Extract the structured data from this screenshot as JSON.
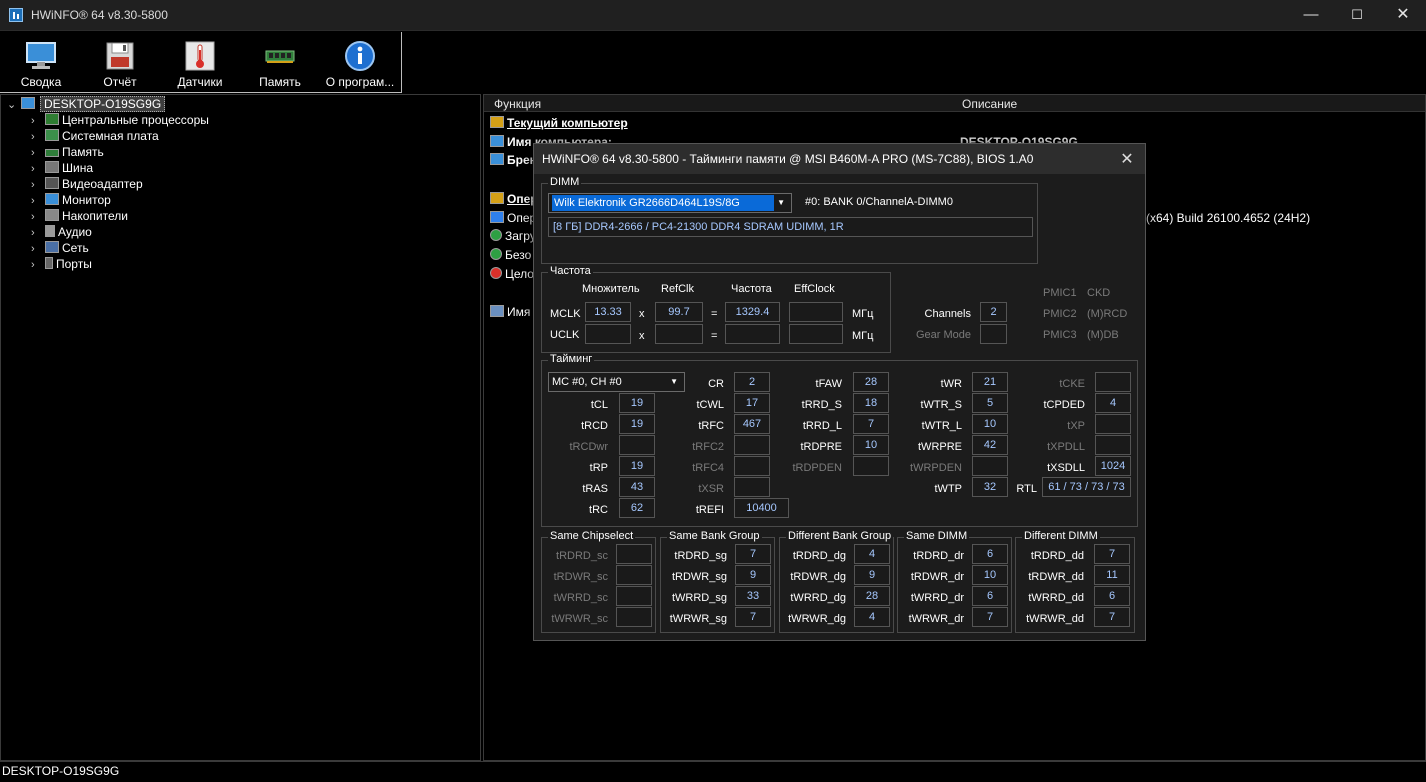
{
  "window": {
    "title": "HWiNFO® 64 v8.30-5800"
  },
  "toolbar": {
    "items": [
      {
        "label": "Сводка",
        "icon": "monitor-icon"
      },
      {
        "label": "Отчёт",
        "icon": "floppy-icon"
      },
      {
        "label": "Датчики",
        "icon": "thermometer-icon"
      },
      {
        "label": "Память",
        "icon": "memory-module-icon"
      },
      {
        "label": "О програм...",
        "icon": "info-icon"
      }
    ]
  },
  "tree": {
    "root": "DESKTOP-O19SG9G",
    "items": [
      {
        "label": "Центральные процессоры"
      },
      {
        "label": "Системная плата"
      },
      {
        "label": "Память"
      },
      {
        "label": "Шина"
      },
      {
        "label": "Видеоадаптер"
      },
      {
        "label": "Монитор"
      },
      {
        "label": "Накопители"
      },
      {
        "label": "Аудио"
      },
      {
        "label": "Сеть"
      },
      {
        "label": "Порты"
      }
    ]
  },
  "details": {
    "col_function": "Функция",
    "col_description": "Описание",
    "rows": [
      {
        "label": "Текущий компьютер"
      },
      {
        "label": "Имя компьютера:"
      },
      {
        "label": "Брен"
      },
      {
        "label": "Опер"
      },
      {
        "label": "Опер"
      },
      {
        "label": "Загру"
      },
      {
        "label": "Безо"
      },
      {
        "label": "Цело"
      },
      {
        "label": "Имя"
      }
    ],
    "desc_computer": "DESKTOP-O19SG9G",
    "desc_os": "l (x64) Build 26100.4652 (24H2)"
  },
  "statusbar": {
    "text": "DESKTOP-O19SG9G"
  },
  "dialog": {
    "title": "HWiNFO® 64 v8.30-5800 - Тайминги памяти @ MSI B460M-A PRO (MS-7C88), BIOS 1.A0",
    "dimm": {
      "group": "DIMM",
      "module": "Wilk Elektronik GR2666D464L19S/8G",
      "slot": "#0: BANK 0/ChannelA-DIMM0",
      "info": "[8 ГБ] DDR4-2666 / PC4-21300 DDR4 SDRAM UDIMM, 1R"
    },
    "freq": {
      "group": "Частота",
      "h_mult": "Множитель",
      "h_refclk": "RefClk",
      "h_freq": "Частота",
      "h_eff": "EffClock",
      "mclk": "MCLK",
      "uclk": "UCLK",
      "mult": "13.33",
      "refclk": "99.7",
      "freq": "1329.4",
      "x": "x",
      "eq": "=",
      "unit": "МГц"
    },
    "side": {
      "channels_label": "Channels",
      "channels": "2",
      "gearmode": "Gear Mode",
      "pmic1": "PMIC1",
      "pmic2": "PMIC2",
      "pmic3": "PMIC3",
      "ckd": "CKD",
      "mrcd": "(M)RCD",
      "mdb": "(M)DB"
    },
    "timing": {
      "group": "Тайминг",
      "mc": "MC #0, CH #0",
      "tCL": "19",
      "tRCD": "19",
      "tRP": "19",
      "tRAS": "43",
      "tRC": "62",
      "CR": "2",
      "tCWL": "17",
      "tRFC": "467",
      "tREFI": "10400",
      "tFAW": "28",
      "tRRD_S": "18",
      "tRRD_L": "7",
      "tRDPRE": "10",
      "tWR": "21",
      "tWTR_S": "5",
      "tWTR_L": "10",
      "tWRPRE": "42",
      "tWTP": "32",
      "tCPDED": "4",
      "tXSDLL": "1024",
      "RTL": "61 / 73 / 73 / 73"
    },
    "groups": {
      "sc": {
        "title": "Same Chipselect",
        "rows": [
          {
            "label": "tRDRD_sc",
            "value": ""
          },
          {
            "label": "tRDWR_sc",
            "value": ""
          },
          {
            "label": "tWRRD_sc",
            "value": ""
          },
          {
            "label": "tWRWR_sc",
            "value": ""
          }
        ]
      },
      "sg": {
        "title": "Same Bank Group",
        "rows": [
          {
            "label": "tRDRD_sg",
            "value": "7"
          },
          {
            "label": "tRDWR_sg",
            "value": "9"
          },
          {
            "label": "tWRRD_sg",
            "value": "33"
          },
          {
            "label": "tWRWR_sg",
            "value": "7"
          }
        ]
      },
      "dg": {
        "title": "Different Bank Group",
        "rows": [
          {
            "label": "tRDRD_dg",
            "value": "4"
          },
          {
            "label": "tRDWR_dg",
            "value": "9"
          },
          {
            "label": "tWRRD_dg",
            "value": "28"
          },
          {
            "label": "tWRWR_dg",
            "value": "4"
          }
        ]
      },
      "dr": {
        "title": "Same DIMM",
        "rows": [
          {
            "label": "tRDRD_dr",
            "value": "6"
          },
          {
            "label": "tRDWR_dr",
            "value": "10"
          },
          {
            "label": "tWRRD_dr",
            "value": "6"
          },
          {
            "label": "tWRWR_dr",
            "value": "7"
          }
        ]
      },
      "dd": {
        "title": "Different DIMM",
        "rows": [
          {
            "label": "tRDRD_dd",
            "value": "7"
          },
          {
            "label": "tRDWR_dd",
            "value": "11"
          },
          {
            "label": "tWRRD_dd",
            "value": "6"
          },
          {
            "label": "tWRWR_dd",
            "value": "7"
          }
        ]
      }
    }
  }
}
